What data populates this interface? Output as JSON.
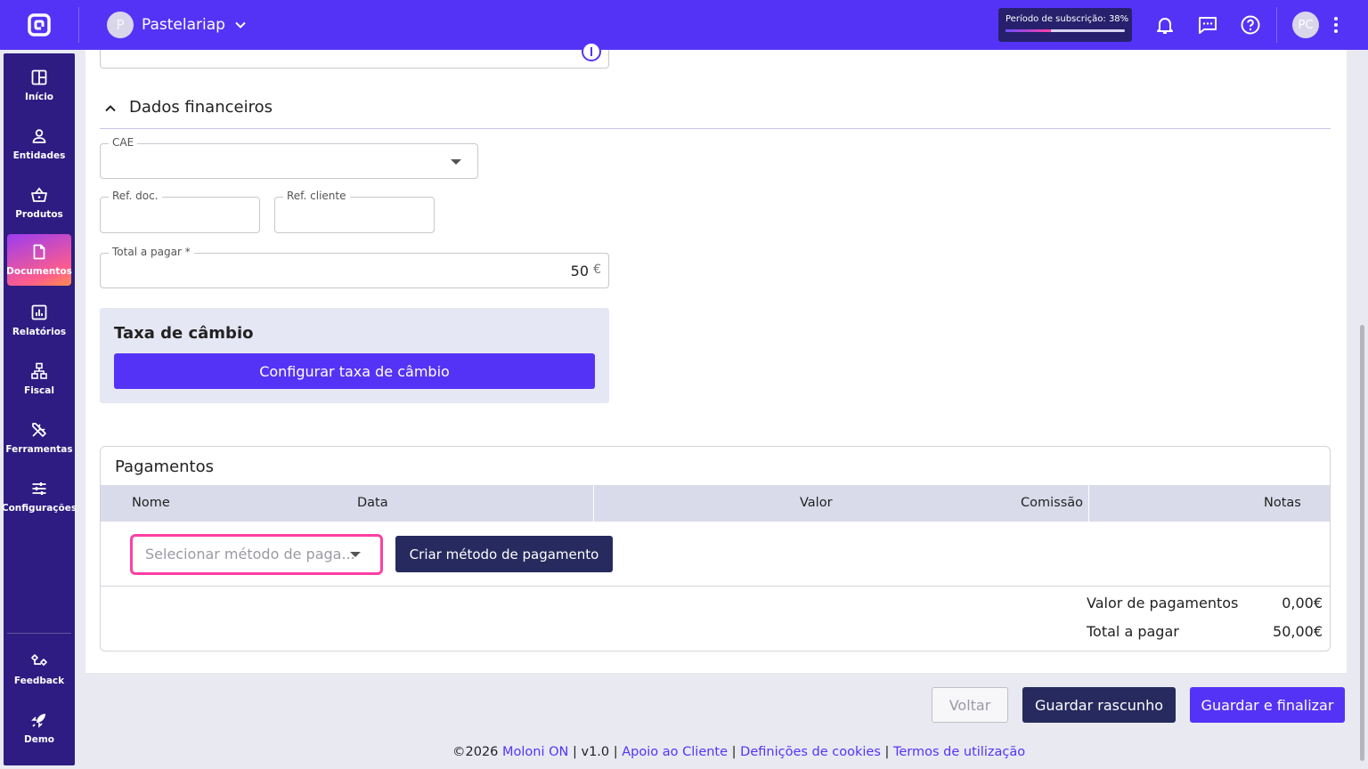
{
  "header": {
    "company_initial": "P",
    "company_name": "Pastelariap",
    "subscription_text": "Período de subscrição: 38%",
    "subscription_progress": 0.38,
    "user_initials": "PC"
  },
  "sidebar": {
    "items": [
      {
        "label": "Início",
        "icon": "dashboard-icon"
      },
      {
        "label": "Entidades",
        "icon": "person-icon"
      },
      {
        "label": "Produtos",
        "icon": "basket-icon"
      },
      {
        "label": "Documentos",
        "icon": "document-icon",
        "active": true
      },
      {
        "label": "Relatórios",
        "icon": "report-icon"
      },
      {
        "label": "Fiscal",
        "icon": "fiscal-icon"
      },
      {
        "label": "Ferramentas",
        "icon": "tools-icon"
      },
      {
        "label": "Configurações",
        "icon": "sliders-icon"
      }
    ],
    "bottom": [
      {
        "label": "Feedback",
        "icon": "feedback-icon"
      },
      {
        "label": "Demo",
        "icon": "rocket-icon"
      }
    ]
  },
  "financial": {
    "section_title": "Dados financeiros",
    "cae_label": "CAE",
    "cae_value": "",
    "ref_doc_label": "Ref. doc.",
    "ref_doc_value": "",
    "ref_client_label": "Ref. cliente",
    "ref_client_value": "",
    "total_label": "Total a pagar *",
    "total_value": "50",
    "currency": "€"
  },
  "exchange": {
    "title": "Taxa de câmbio",
    "button": "Configurar taxa de câmbio"
  },
  "payments": {
    "title": "Pagamentos",
    "columns": [
      "Nome",
      "Data",
      "Valor",
      "Comissão",
      "Notas"
    ],
    "select_placeholder": "Selecionar método de paga...",
    "create_button": "Criar método de pagamento",
    "summary": [
      {
        "label": "Valor de pagamentos",
        "value": "0,00€"
      },
      {
        "label": "Total a pagar",
        "value": "50,00€"
      }
    ]
  },
  "actions": {
    "back": "Voltar",
    "draft": "Guardar rascunho",
    "finalize": "Guardar e finalizar"
  },
  "footer": {
    "copyright": "©2026",
    "brand": "Moloni ON",
    "version": "v1.0",
    "support": "Apoio ao Cliente",
    "cookies": "Definições de cookies",
    "terms": "Termos de utilização",
    "sep": "|"
  },
  "colors": {
    "brand": "#5533f6",
    "sidebar": "#2e1c82",
    "dark_button": "#262a5e",
    "highlight": "#ff3fa4"
  }
}
